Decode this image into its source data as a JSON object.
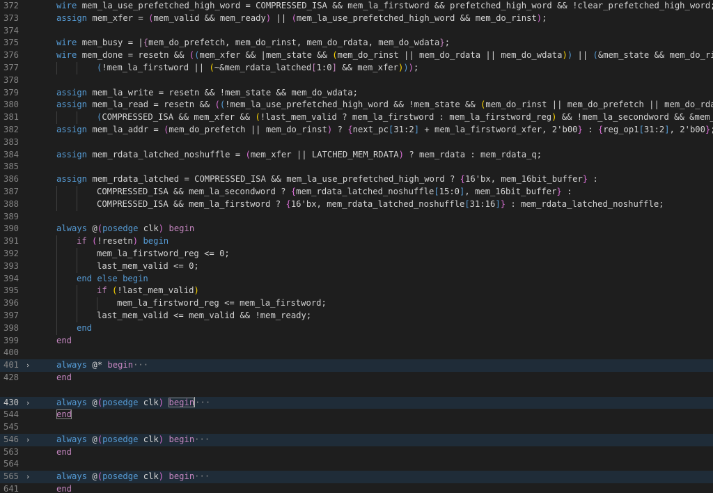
{
  "editor": {
    "language": "verilog",
    "active_line": "430",
    "lines": [
      {
        "num": "372",
        "indent": 1,
        "fold": false,
        "hl": false,
        "segs": [
          [
            "kw",
            "wire"
          ],
          [
            "txt",
            " mem_la_use_prefetched_high_word = COMPRESSED_ISA && mem_la_firstword && prefetched_high_word && !clear_prefetched_high_word;"
          ]
        ]
      },
      {
        "num": "373",
        "indent": 1,
        "fold": false,
        "hl": false,
        "segs": [
          [
            "kw",
            "assign"
          ],
          [
            "txt",
            " mem_xfer = "
          ],
          [
            "brk",
            "("
          ],
          [
            "txt",
            "mem_valid && mem_ready"
          ],
          [
            "brk",
            ")"
          ],
          [
            "txt",
            " || "
          ],
          [
            "brk",
            "("
          ],
          [
            "txt",
            "mem_la_use_prefetched_high_word && mem_do_rinst"
          ],
          [
            "brk",
            ")"
          ],
          [
            "txt",
            ";"
          ]
        ]
      },
      {
        "num": "374",
        "indent": 0,
        "fold": false,
        "hl": false,
        "segs": []
      },
      {
        "num": "375",
        "indent": 1,
        "fold": false,
        "hl": false,
        "segs": [
          [
            "kw",
            "wire"
          ],
          [
            "txt",
            " mem_busy = |"
          ],
          [
            "ctl",
            "{"
          ],
          [
            "txt",
            "mem_do_prefetch, mem_do_rinst, mem_do_rdata, mem_do_wdata"
          ],
          [
            "ctl",
            "}"
          ],
          [
            "txt",
            ";"
          ]
        ]
      },
      {
        "num": "376",
        "indent": 1,
        "fold": false,
        "hl": false,
        "segs": [
          [
            "kw",
            "wire"
          ],
          [
            "txt",
            " mem_done = resetn && "
          ],
          [
            "brk",
            "("
          ],
          [
            "kw",
            "("
          ],
          [
            "txt",
            "mem_xfer && |mem_state && "
          ],
          [
            "ylw",
            "("
          ],
          [
            "txt",
            "mem_do_rinst || mem_do_rdata || mem_do_wdata"
          ],
          [
            "ylw",
            ")"
          ],
          [
            "kw",
            ")"
          ],
          [
            "txt",
            " || "
          ],
          [
            "kw",
            "("
          ],
          [
            "txt",
            "&mem_state && mem_do_rins"
          ]
        ]
      },
      {
        "num": "377",
        "indent": 3,
        "fold": false,
        "hl": false,
        "segs": [
          [
            "kw",
            "("
          ],
          [
            "txt",
            "!mem_la_firstword || "
          ],
          [
            "ylw",
            "("
          ],
          [
            "txt",
            "~&mem_rdata_latched"
          ],
          [
            "ctl",
            "["
          ],
          [
            "txt",
            "1:0"
          ],
          [
            "ctl",
            "]"
          ],
          [
            "txt",
            " && mem_xfer"
          ],
          [
            "ylw",
            ")"
          ],
          [
            "kw",
            ")"
          ],
          [
            "brk",
            ")"
          ],
          [
            "txt",
            ";"
          ]
        ]
      },
      {
        "num": "378",
        "indent": 0,
        "fold": false,
        "hl": false,
        "segs": []
      },
      {
        "num": "379",
        "indent": 1,
        "fold": false,
        "hl": false,
        "segs": [
          [
            "kw",
            "assign"
          ],
          [
            "txt",
            " mem_la_write = resetn && !mem_state && mem_do_wdata;"
          ]
        ]
      },
      {
        "num": "380",
        "indent": 1,
        "fold": false,
        "hl": false,
        "segs": [
          [
            "kw",
            "assign"
          ],
          [
            "txt",
            " mem_la_read = resetn && "
          ],
          [
            "brk",
            "("
          ],
          [
            "kw",
            "("
          ],
          [
            "txt",
            "!mem_la_use_prefetched_high_word && !mem_state && "
          ],
          [
            "ylw",
            "("
          ],
          [
            "txt",
            "mem_do_rinst || mem_do_prefetch || mem_do_rdata"
          ]
        ]
      },
      {
        "num": "381",
        "indent": 3,
        "fold": false,
        "hl": false,
        "segs": [
          [
            "kw",
            "("
          ],
          [
            "txt",
            "COMPRESSED_ISA && mem_xfer && "
          ],
          [
            "ylw",
            "("
          ],
          [
            "txt",
            "!last_mem_valid ? mem_la_firstword : mem_la_firstword_reg"
          ],
          [
            "ylw",
            ")"
          ],
          [
            "txt",
            " && !mem_la_secondword && &mem_rd"
          ]
        ]
      },
      {
        "num": "382",
        "indent": 1,
        "fold": false,
        "hl": false,
        "segs": [
          [
            "kw",
            "assign"
          ],
          [
            "txt",
            " mem_la_addr = "
          ],
          [
            "brk",
            "("
          ],
          [
            "txt",
            "mem_do_prefetch || mem_do_rinst"
          ],
          [
            "brk",
            ")"
          ],
          [
            "txt",
            " ? "
          ],
          [
            "brk",
            "{"
          ],
          [
            "txt",
            "next_pc"
          ],
          [
            "kw",
            "["
          ],
          [
            "txt",
            "31:2"
          ],
          [
            "kw",
            "]"
          ],
          [
            "txt",
            " + mem_la_firstword_xfer, 2'b00"
          ],
          [
            "brk",
            "}"
          ],
          [
            "txt",
            " : "
          ],
          [
            "brk",
            "{"
          ],
          [
            "txt",
            "reg_op1"
          ],
          [
            "kw",
            "["
          ],
          [
            "txt",
            "31:2"
          ],
          [
            "kw",
            "]"
          ],
          [
            "txt",
            ", 2'b00"
          ],
          [
            "brk",
            "}"
          ],
          [
            "txt",
            ";"
          ]
        ]
      },
      {
        "num": "383",
        "indent": 0,
        "fold": false,
        "hl": false,
        "segs": []
      },
      {
        "num": "384",
        "indent": 1,
        "fold": false,
        "hl": false,
        "segs": [
          [
            "kw",
            "assign"
          ],
          [
            "txt",
            " mem_rdata_latched_noshuffle = "
          ],
          [
            "brk",
            "("
          ],
          [
            "txt",
            "mem_xfer || LATCHED_MEM_RDATA"
          ],
          [
            "brk",
            ")"
          ],
          [
            "txt",
            " ? mem_rdata : mem_rdata_q;"
          ]
        ]
      },
      {
        "num": "385",
        "indent": 0,
        "fold": false,
        "hl": false,
        "segs": []
      },
      {
        "num": "386",
        "indent": 1,
        "fold": false,
        "hl": false,
        "segs": [
          [
            "kw",
            "assign"
          ],
          [
            "txt",
            " mem_rdata_latched = COMPRESSED_ISA && mem_la_use_prefetched_high_word ? "
          ],
          [
            "brk",
            "{"
          ],
          [
            "txt",
            "16'bx, mem_16bit_buffer"
          ],
          [
            "brk",
            "}"
          ],
          [
            "txt",
            " :"
          ]
        ]
      },
      {
        "num": "387",
        "indent": 3,
        "fold": false,
        "hl": false,
        "segs": [
          [
            "txt",
            "COMPRESSED_ISA && mem_la_secondword ? "
          ],
          [
            "brk",
            "{"
          ],
          [
            "txt",
            "mem_rdata_latched_noshuffle"
          ],
          [
            "kw",
            "["
          ],
          [
            "txt",
            "15:0"
          ],
          [
            "kw",
            "]"
          ],
          [
            "txt",
            ", mem_16bit_buffer"
          ],
          [
            "brk",
            "}"
          ],
          [
            "txt",
            " :"
          ]
        ]
      },
      {
        "num": "388",
        "indent": 3,
        "fold": false,
        "hl": false,
        "segs": [
          [
            "txt",
            "COMPRESSED_ISA && mem_la_firstword ? "
          ],
          [
            "brk",
            "{"
          ],
          [
            "txt",
            "16'bx, mem_rdata_latched_noshuffle"
          ],
          [
            "kw",
            "["
          ],
          [
            "txt",
            "31:16"
          ],
          [
            "kw",
            "]"
          ],
          [
            "brk",
            "}"
          ],
          [
            "txt",
            " : mem_rdata_latched_noshuffle;"
          ]
        ]
      },
      {
        "num": "389",
        "indent": 0,
        "fold": false,
        "hl": false,
        "segs": []
      },
      {
        "num": "390",
        "indent": 1,
        "fold": false,
        "hl": false,
        "segs": [
          [
            "kw",
            "always"
          ],
          [
            "txt",
            " @"
          ],
          [
            "brk",
            "("
          ],
          [
            "kw",
            "posedge"
          ],
          [
            "txt",
            " clk"
          ],
          [
            "brk",
            ")"
          ],
          [
            "txt",
            " "
          ],
          [
            "ctl",
            "begin"
          ]
        ]
      },
      {
        "num": "391",
        "indent": 2,
        "fold": false,
        "hl": false,
        "segs": [
          [
            "ctl",
            "if"
          ],
          [
            "txt",
            " "
          ],
          [
            "brk",
            "("
          ],
          [
            "txt",
            "!resetn"
          ],
          [
            "brk",
            ")"
          ],
          [
            "txt",
            " "
          ],
          [
            "kw",
            "begin"
          ]
        ]
      },
      {
        "num": "392",
        "indent": 3,
        "fold": false,
        "hl": false,
        "segs": [
          [
            "txt",
            "mem_la_firstword_reg <= 0;"
          ]
        ]
      },
      {
        "num": "393",
        "indent": 3,
        "fold": false,
        "hl": false,
        "segs": [
          [
            "txt",
            "last_mem_valid <= 0;"
          ]
        ]
      },
      {
        "num": "394",
        "indent": 2,
        "fold": false,
        "hl": false,
        "segs": [
          [
            "kw",
            "end"
          ],
          [
            "txt",
            " "
          ],
          [
            "kw",
            "else"
          ],
          [
            "txt",
            " "
          ],
          [
            "kw",
            "begin"
          ]
        ]
      },
      {
        "num": "395",
        "indent": 3,
        "fold": false,
        "hl": false,
        "segs": [
          [
            "ctl",
            "if"
          ],
          [
            "txt",
            " "
          ],
          [
            "ylw",
            "("
          ],
          [
            "txt",
            "!last_mem_valid"
          ],
          [
            "ylw",
            ")"
          ]
        ]
      },
      {
        "num": "396",
        "indent": 4,
        "fold": false,
        "hl": false,
        "segs": [
          [
            "txt",
            "mem_la_firstword_reg <= mem_la_firstword;"
          ]
        ]
      },
      {
        "num": "397",
        "indent": 3,
        "fold": false,
        "hl": false,
        "segs": [
          [
            "txt",
            "last_mem_valid <= mem_valid && !mem_ready;"
          ]
        ]
      },
      {
        "num": "398",
        "indent": 2,
        "fold": false,
        "hl": false,
        "segs": [
          [
            "kw",
            "end"
          ]
        ]
      },
      {
        "num": "399",
        "indent": 1,
        "fold": false,
        "hl": false,
        "segs": [
          [
            "ctl",
            "end"
          ]
        ]
      },
      {
        "num": "400",
        "indent": 0,
        "fold": false,
        "hl": false,
        "segs": []
      },
      {
        "num": "401",
        "indent": 1,
        "fold": true,
        "hl": true,
        "segs": [
          [
            "kw",
            "always"
          ],
          [
            "txt",
            " @* "
          ],
          [
            "ctl",
            "begin"
          ],
          [
            "fld",
            "···"
          ]
        ]
      },
      {
        "num": "428",
        "indent": 1,
        "fold": false,
        "hl": false,
        "segs": [
          [
            "ctl",
            "end"
          ]
        ]
      },
      {
        "num": "429",
        "indent": 0,
        "fold": false,
        "hl": false,
        "hidden_num": true,
        "segs": []
      },
      {
        "num": "430",
        "indent": 1,
        "fold": true,
        "hl": true,
        "cur": true,
        "segs": [
          [
            "kw",
            "always"
          ],
          [
            "txt",
            " @"
          ],
          [
            "brk",
            "("
          ],
          [
            "kw",
            "posedge"
          ],
          [
            "txt",
            " clk"
          ],
          [
            "brk",
            ")"
          ],
          [
            "txt",
            " "
          ],
          [
            "ctl",
            "begin",
            "box"
          ],
          [
            "caret",
            ""
          ],
          [
            "fld",
            "···"
          ]
        ]
      },
      {
        "num": "544",
        "indent": 1,
        "fold": false,
        "hl": false,
        "segs": [
          [
            "ctl",
            "end",
            "box"
          ]
        ]
      },
      {
        "num": "545",
        "indent": 0,
        "fold": false,
        "hl": false,
        "segs": []
      },
      {
        "num": "546",
        "indent": 1,
        "fold": true,
        "hl": true,
        "segs": [
          [
            "kw",
            "always"
          ],
          [
            "txt",
            " @"
          ],
          [
            "brk",
            "("
          ],
          [
            "kw",
            "posedge"
          ],
          [
            "txt",
            " clk"
          ],
          [
            "brk",
            ")"
          ],
          [
            "txt",
            " "
          ],
          [
            "ctl",
            "begin"
          ],
          [
            "fld",
            "···"
          ]
        ]
      },
      {
        "num": "563",
        "indent": 1,
        "fold": false,
        "hl": false,
        "segs": [
          [
            "ctl",
            "end"
          ]
        ]
      },
      {
        "num": "564",
        "indent": 0,
        "fold": false,
        "hl": false,
        "segs": []
      },
      {
        "num": "565",
        "indent": 1,
        "fold": true,
        "hl": true,
        "segs": [
          [
            "kw",
            "always"
          ],
          [
            "txt",
            " @"
          ],
          [
            "brk",
            "("
          ],
          [
            "kw",
            "posedge"
          ],
          [
            "txt",
            " clk"
          ],
          [
            "brk",
            ")"
          ],
          [
            "txt",
            " "
          ],
          [
            "ctl",
            "begin"
          ],
          [
            "fld",
            "···"
          ]
        ]
      },
      {
        "num": "641",
        "indent": 1,
        "fold": false,
        "hl": false,
        "segs": [
          [
            "ctl",
            "end"
          ]
        ]
      }
    ]
  },
  "icons": {
    "fold": "chevron-right-icon"
  },
  "colors": {
    "background": "#1e1e1e",
    "keyword": "#569cd6",
    "control": "#c586c0",
    "text": "#d4d4d4",
    "bracket_gold": "#ffd700"
  }
}
